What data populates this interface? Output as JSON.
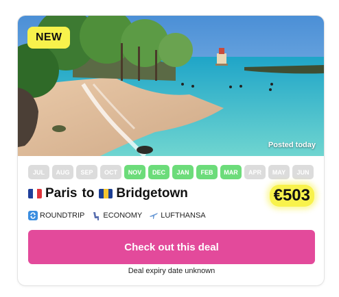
{
  "card": {
    "badge": "NEW",
    "posted": "Posted today",
    "months": [
      {
        "label": "JUL",
        "active": false
      },
      {
        "label": "AUG",
        "active": false
      },
      {
        "label": "SEP",
        "active": false
      },
      {
        "label": "OCT",
        "active": false
      },
      {
        "label": "NOV",
        "active": true
      },
      {
        "label": "DEC",
        "active": true
      },
      {
        "label": "JAN",
        "active": true
      },
      {
        "label": "FEB",
        "active": true
      },
      {
        "label": "MAR",
        "active": true
      },
      {
        "label": "APR",
        "active": false
      },
      {
        "label": "MAY",
        "active": false
      },
      {
        "label": "JUN",
        "active": false
      }
    ],
    "route": {
      "origin": "Paris",
      "connector": "to",
      "destination": "Bridgetown",
      "origin_flag_icon": "france-flag-icon",
      "destination_flag_icon": "barbados-flag-icon"
    },
    "price": "€503",
    "meta": {
      "trip_type": "ROUNDTRIP",
      "cabin": "ECONOMY",
      "airline": "LUFTHANSA"
    },
    "cta_label": "Check out this deal",
    "expiry": "Deal expiry date unknown"
  },
  "colors": {
    "accent": "#e34a9b",
    "highlight": "#f8f24c",
    "month_active": "#6cdc7a",
    "month_inactive": "#dcdcdc"
  }
}
